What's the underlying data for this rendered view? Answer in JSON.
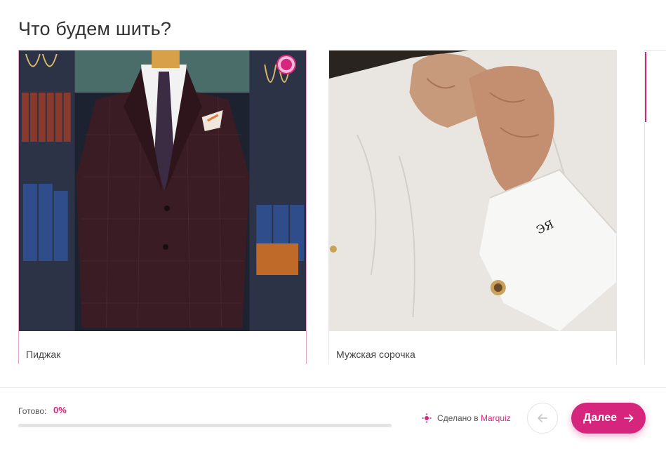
{
  "quiz": {
    "question": "Что будем шить?",
    "options": [
      {
        "label": "Пиджак",
        "selected": true
      },
      {
        "label": "Мужская сорочка",
        "selected": false
      }
    ]
  },
  "footer": {
    "progress_label": "Готово:",
    "progress_value": "0%",
    "progress_fraction": 0,
    "made_in_text": "Сделано в",
    "made_in_brand": "Marquiz",
    "back_icon": "arrow-left-icon",
    "next_label": "Далее",
    "next_icon": "arrow-right-icon"
  },
  "colors": {
    "accent": "#d6257c",
    "accent_light": "#f2b8d6",
    "border": "#e6e6e6",
    "text": "#333333"
  }
}
